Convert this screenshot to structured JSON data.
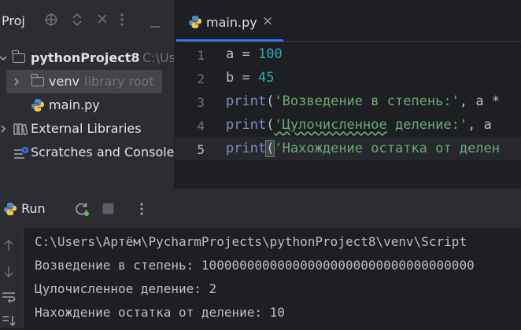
{
  "project_pane": {
    "title": "Proj",
    "tree": {
      "project": {
        "name": "pythonProject8",
        "path_hint": "C:\\Us"
      },
      "venv": {
        "name": "venv",
        "hint": "library root"
      },
      "main_file": "main.py",
      "external": "External Libraries",
      "scratches": "Scratches and Consoles"
    }
  },
  "editor": {
    "tab": {
      "label": "main.py",
      "close": "×"
    },
    "line_numbers": [
      "1",
      "2",
      "3",
      "4",
      "5"
    ],
    "lines": {
      "l1": {
        "a": "a",
        "eq": " = ",
        "val": "100"
      },
      "l2": {
        "b": "b",
        "eq": " = ",
        "val": "45"
      },
      "l3": {
        "fn": "print",
        "open": "(",
        "str": "'Возведение в степень:'",
        "rest": ", a *"
      },
      "l4": {
        "fn": "print",
        "open": "(",
        "str_wavy": "'Цулочисленное",
        "str_rest": " деление:'",
        "rest": ", a"
      },
      "l5": {
        "fn": "print",
        "open": "(",
        "str": "'Нахождение остатка от делен"
      }
    }
  },
  "run_panel": {
    "label": "Run",
    "output": [
      "C:\\Users\\Артём\\PycharmProjects\\pythonProject8\\venv\\Script",
      "Возведение в степень: 100000000000000000000000000000000000",
      "Цулочисленное деление: 2",
      "Нахождение остатка от деление: 10"
    ]
  },
  "colors": {
    "accent": "#3574f0",
    "string": "#6aab73",
    "number": "#2aacb8",
    "builtin": "#8888c6"
  }
}
